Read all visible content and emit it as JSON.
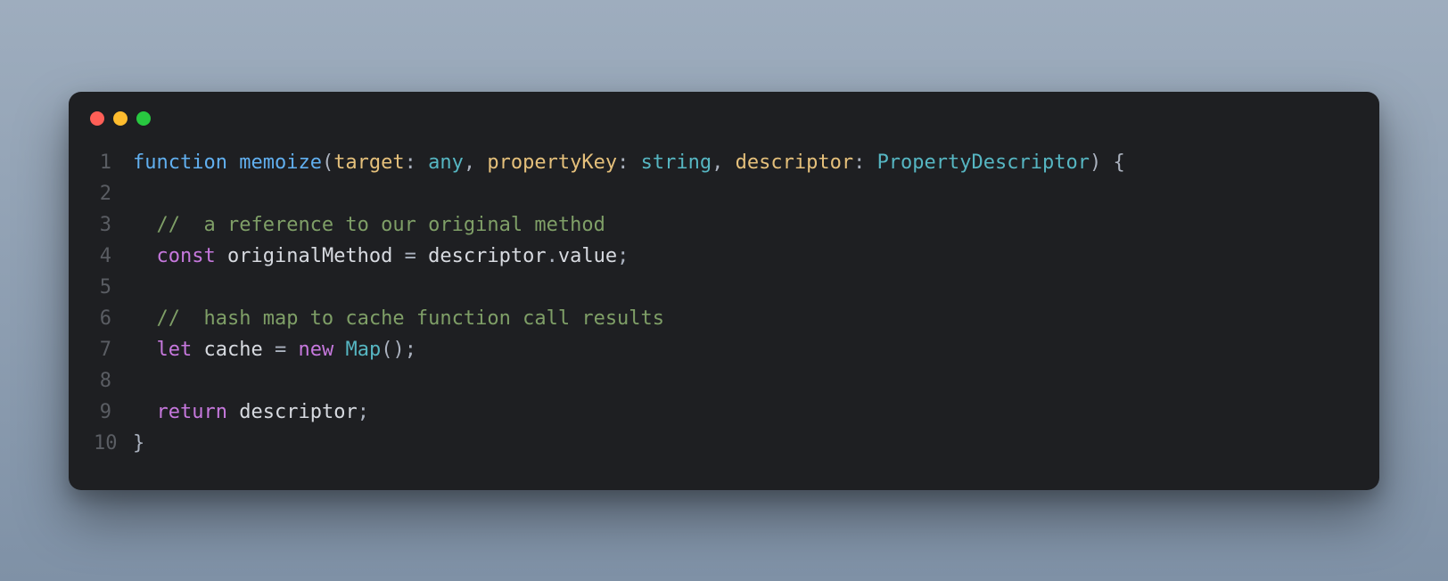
{
  "trafficLights": [
    "red",
    "yellow",
    "green"
  ],
  "code": {
    "lines": [
      {
        "n": "1",
        "tokens": [
          {
            "c": "tk-keyword-blue",
            "t": "function"
          },
          {
            "c": "tk-punct",
            "t": " "
          },
          {
            "c": "tk-fn",
            "t": "memoize"
          },
          {
            "c": "tk-punct",
            "t": "("
          },
          {
            "c": "tk-param",
            "t": "target"
          },
          {
            "c": "tk-punct",
            "t": ": "
          },
          {
            "c": "tk-type",
            "t": "any"
          },
          {
            "c": "tk-punct",
            "t": ", "
          },
          {
            "c": "tk-param",
            "t": "propertyKey"
          },
          {
            "c": "tk-punct",
            "t": ": "
          },
          {
            "c": "tk-type",
            "t": "string"
          },
          {
            "c": "tk-punct",
            "t": ", "
          },
          {
            "c": "tk-param",
            "t": "descriptor"
          },
          {
            "c": "tk-punct",
            "t": ": "
          },
          {
            "c": "tk-class",
            "t": "PropertyDescriptor"
          },
          {
            "c": "tk-punct",
            "t": ") {"
          }
        ]
      },
      {
        "n": "2",
        "tokens": []
      },
      {
        "n": "3",
        "tokens": [
          {
            "c": "tk-plain",
            "t": "  "
          },
          {
            "c": "tk-comment",
            "t": "//  a reference to our original method"
          }
        ]
      },
      {
        "n": "4",
        "tokens": [
          {
            "c": "tk-plain",
            "t": "  "
          },
          {
            "c": "tk-keyword",
            "t": "const"
          },
          {
            "c": "tk-plain",
            "t": " "
          },
          {
            "c": "tk-plain",
            "t": "originalMethod"
          },
          {
            "c": "tk-plain",
            "t": " "
          },
          {
            "c": "tk-punct",
            "t": "="
          },
          {
            "c": "tk-plain",
            "t": " "
          },
          {
            "c": "tk-plain",
            "t": "descriptor"
          },
          {
            "c": "tk-punct",
            "t": "."
          },
          {
            "c": "tk-plain",
            "t": "value"
          },
          {
            "c": "tk-punct",
            "t": ";"
          }
        ]
      },
      {
        "n": "5",
        "tokens": []
      },
      {
        "n": "6",
        "tokens": [
          {
            "c": "tk-plain",
            "t": "  "
          },
          {
            "c": "tk-comment",
            "t": "//  hash map to cache function call results"
          }
        ]
      },
      {
        "n": "7",
        "tokens": [
          {
            "c": "tk-plain",
            "t": "  "
          },
          {
            "c": "tk-keyword",
            "t": "let"
          },
          {
            "c": "tk-plain",
            "t": " "
          },
          {
            "c": "tk-plain",
            "t": "cache"
          },
          {
            "c": "tk-plain",
            "t": " "
          },
          {
            "c": "tk-punct",
            "t": "="
          },
          {
            "c": "tk-plain",
            "t": " "
          },
          {
            "c": "tk-keyword",
            "t": "new"
          },
          {
            "c": "tk-plain",
            "t": " "
          },
          {
            "c": "tk-class",
            "t": "Map"
          },
          {
            "c": "tk-punct",
            "t": "();"
          }
        ]
      },
      {
        "n": "8",
        "tokens": []
      },
      {
        "n": "9",
        "tokens": [
          {
            "c": "tk-plain",
            "t": "  "
          },
          {
            "c": "tk-keyword",
            "t": "return"
          },
          {
            "c": "tk-plain",
            "t": " "
          },
          {
            "c": "tk-plain",
            "t": "descriptor"
          },
          {
            "c": "tk-punct",
            "t": ";"
          }
        ]
      },
      {
        "n": "10",
        "tokens": [
          {
            "c": "tk-punct",
            "t": "}"
          }
        ]
      }
    ]
  }
}
